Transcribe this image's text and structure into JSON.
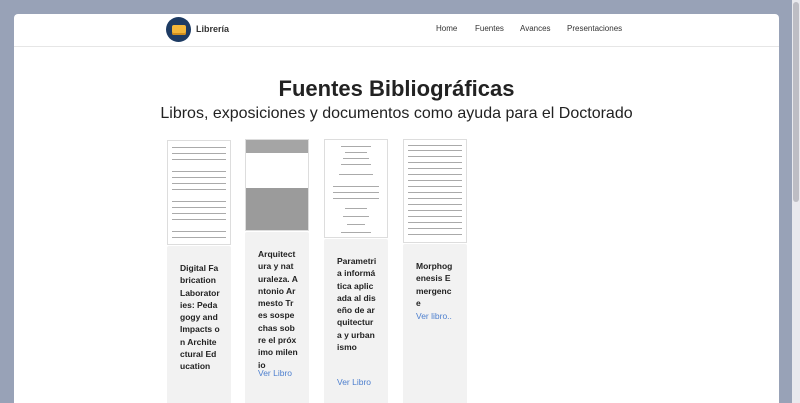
{
  "nav": {
    "brand": "Librería",
    "items": [
      "Home",
      "Fuentes",
      "Avances",
      "Presentaciones"
    ]
  },
  "hero": {
    "title": "Fuentes Bibliográficas",
    "subtitle": "Libros, exposiciones y documentos como ayuda para el Doctorado"
  },
  "cards": [
    {
      "title": "Digital Fabrication Laboratories: Pedagogy and Impacts on Architectural Education",
      "link": ""
    },
    {
      "title": "Arquitectura y naturaleza. Antonio Armesto Tres sospechas sobre el próximo milenio",
      "link": "Ver Libro"
    },
    {
      "title": "Parametria informática aplicada al diseño de arquitectura y urbanismo",
      "link": "Ver Libro"
    },
    {
      "title": "Morphogenesis Emergence",
      "link": "Ver libro.."
    }
  ]
}
